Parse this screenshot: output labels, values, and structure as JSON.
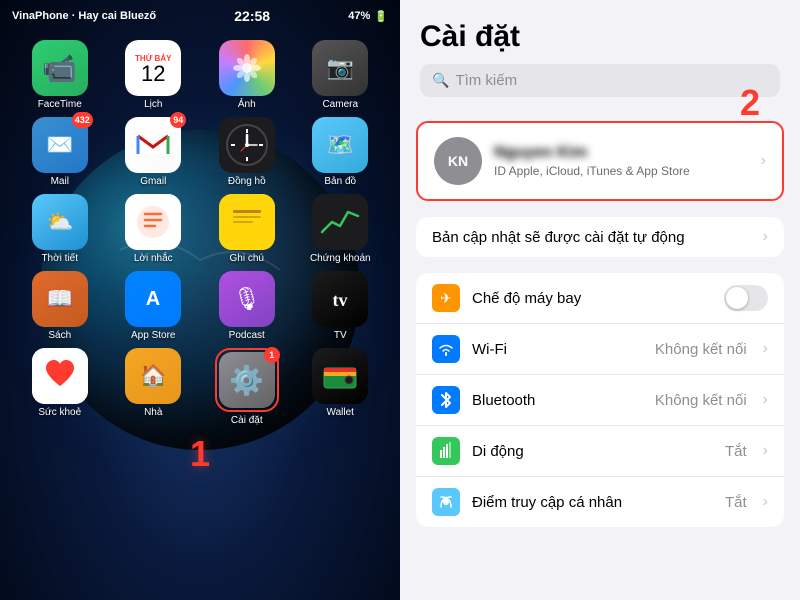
{
  "left": {
    "status": {
      "carrier": "VinaPhone · Hay cai Bluező",
      "time": "22:58",
      "battery": "47%"
    },
    "apps": [
      {
        "id": "facetime",
        "label": "FaceTime",
        "icon": "facetime",
        "badge": null,
        "emoji": "📹"
      },
      {
        "id": "calendar",
        "label": "Lịch",
        "icon": "calendar",
        "badge": null,
        "emoji": "cal"
      },
      {
        "id": "photos",
        "label": "Ảnh",
        "icon": "photos",
        "badge": null,
        "emoji": "photos"
      },
      {
        "id": "camera",
        "label": "Camera",
        "icon": "camera",
        "badge": null,
        "emoji": "📷"
      },
      {
        "id": "mail",
        "label": "Mail",
        "icon": "mail",
        "badge": "432",
        "emoji": "✉️"
      },
      {
        "id": "gmail",
        "label": "Gmail",
        "icon": "gmail",
        "badge": "94",
        "emoji": "M"
      },
      {
        "id": "clock",
        "label": "Đồng hồ",
        "icon": "clock",
        "badge": null,
        "emoji": "clock"
      },
      {
        "id": "maps",
        "label": "Bản đồ",
        "icon": "maps",
        "badge": null,
        "emoji": "🗺️"
      },
      {
        "id": "weather",
        "label": "Thời tiết",
        "icon": "weather",
        "badge": null,
        "emoji": "⛅"
      },
      {
        "id": "reminder",
        "label": "Lời nhắc",
        "icon": "reminder",
        "badge": null,
        "emoji": "☑️"
      },
      {
        "id": "notes",
        "label": "Ghi chú",
        "icon": "notes",
        "badge": null,
        "emoji": "📝"
      },
      {
        "id": "stocks",
        "label": "Chứng khoán",
        "icon": "stocks",
        "badge": null,
        "emoji": "📈"
      },
      {
        "id": "books",
        "label": "Sách",
        "icon": "books",
        "badge": null,
        "emoji": "📖"
      },
      {
        "id": "appstore",
        "label": "App Store",
        "icon": "appstore",
        "badge": null,
        "emoji": "A"
      },
      {
        "id": "podcasts",
        "label": "Podcast",
        "icon": "podcasts",
        "badge": null,
        "emoji": "🎙"
      },
      {
        "id": "tv",
        "label": "TV",
        "icon": "tv",
        "badge": null,
        "emoji": "tv"
      },
      {
        "id": "health",
        "label": "Sức khoẻ",
        "icon": "health",
        "badge": null,
        "emoji": "❤️"
      },
      {
        "id": "home",
        "label": "Nhà",
        "icon": "home",
        "badge": null,
        "emoji": "🏠"
      },
      {
        "id": "settings",
        "label": "Cài đặt",
        "icon": "settings",
        "badge": "1",
        "emoji": "⚙️",
        "highlighted": true
      },
      {
        "id": "wallet",
        "label": "Wallet",
        "icon": "wallet",
        "badge": null,
        "emoji": "wallet"
      }
    ],
    "step1": "1"
  },
  "right": {
    "title": "Cài đặt",
    "search_placeholder": "Tìm kiếm",
    "step2": "2",
    "apple_id": {
      "initials": "KN",
      "name": "Nguyen Kim",
      "subtitle": "ID Apple, iCloud, iTunes & App Store"
    },
    "auto_update": "Bản cập nhật sẽ được cài đặt tự động",
    "settings_rows": [
      {
        "id": "airplane",
        "label": "Chế độ máy bay",
        "icon_color": "orange",
        "icon_symbol": "✈",
        "value": "",
        "type": "toggle",
        "toggle_on": false
      },
      {
        "id": "wifi",
        "label": "Wi-Fi",
        "icon_color": "blue",
        "icon_symbol": "wifi",
        "value": "Không kết nối",
        "type": "detail"
      },
      {
        "id": "bluetooth",
        "label": "Bluetooth",
        "icon_color": "blue",
        "icon_symbol": "bt",
        "value": "Không kết nối",
        "type": "detail"
      },
      {
        "id": "mobile",
        "label": "Di động",
        "icon_color": "green",
        "icon_symbol": "signal",
        "value": "Tắt",
        "type": "detail"
      },
      {
        "id": "personalspot",
        "label": "Điểm truy cập cá nhân",
        "icon_color": "teal",
        "icon_symbol": "spot",
        "value": "Tắt",
        "type": "detail"
      }
    ]
  }
}
